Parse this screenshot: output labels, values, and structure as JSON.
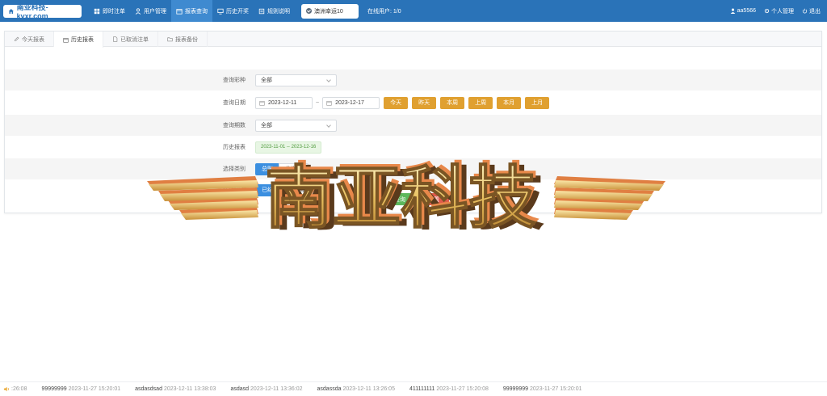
{
  "header": {
    "logo_text": "南亚科技-kvxr.com",
    "nav": [
      {
        "label": "即时注单",
        "icon": "grid-icon",
        "active": false
      },
      {
        "label": "用户管理",
        "icon": "user-icon",
        "active": false
      },
      {
        "label": "报表查询",
        "icon": "calendar-icon",
        "active": true
      },
      {
        "label": "历史开奖",
        "icon": "monitor-icon",
        "active": false
      },
      {
        "label": "规则说明",
        "icon": "book-icon",
        "active": false
      }
    ],
    "lottery": "澳洲幸运10",
    "online": "在线用户: 1/0",
    "user": "aa5566",
    "profile": "个人管理",
    "logout": "退出"
  },
  "tabs": [
    {
      "label": "今天报表",
      "icon": "pen-icon",
      "active": false
    },
    {
      "label": "历史报表",
      "icon": "calendar-icon",
      "active": true
    },
    {
      "label": "已取消注单",
      "icon": "document-icon",
      "active": false
    },
    {
      "label": "报表备份",
      "icon": "folder-icon",
      "active": false
    }
  ],
  "form": {
    "lottery_label": "查询彩种",
    "lottery_value": "全部",
    "date_label": "查询日期",
    "date_start": "2023-12-11",
    "date_end": "2023-12-17",
    "range_sep": "~",
    "quick": [
      "今天",
      "昨天",
      "本周",
      "上周",
      "本月",
      "上月"
    ],
    "period_label": "查询期数",
    "period_value": "全部",
    "history_label": "历史报表",
    "history_range": "2023-11-01 -- 2023-12-16",
    "category_label": "选择类别",
    "category_options": [
      "总账",
      "分类账"
    ],
    "settle_label": "结算状态",
    "settle_options": [
      "已结算",
      "未结算"
    ],
    "submit": "查询",
    "reset": "重置"
  },
  "watermark": "南亚科技",
  "ticker": {
    "lead_time": ":26:08",
    "items": [
      {
        "user": "99999999",
        "time": "2023-11-27 15:20:01"
      },
      {
        "user": "asdasdsad",
        "time": "2023-12-11 13:38:03"
      },
      {
        "user": "asdasd",
        "time": "2023-12-11 13:36:02"
      },
      {
        "user": "asdassda",
        "time": "2023-12-11 13:26:05"
      },
      {
        "user": "411111111",
        "time": "2023-11-27 15:20:08"
      },
      {
        "user": "99999999",
        "time": "2023-11-27 15:20:01"
      }
    ]
  },
  "colors": {
    "topbar": "#2a73b8",
    "quick_button": "#e0a030",
    "segment_on": "#3b8fe0",
    "badge_green": "#4e9a3c"
  }
}
